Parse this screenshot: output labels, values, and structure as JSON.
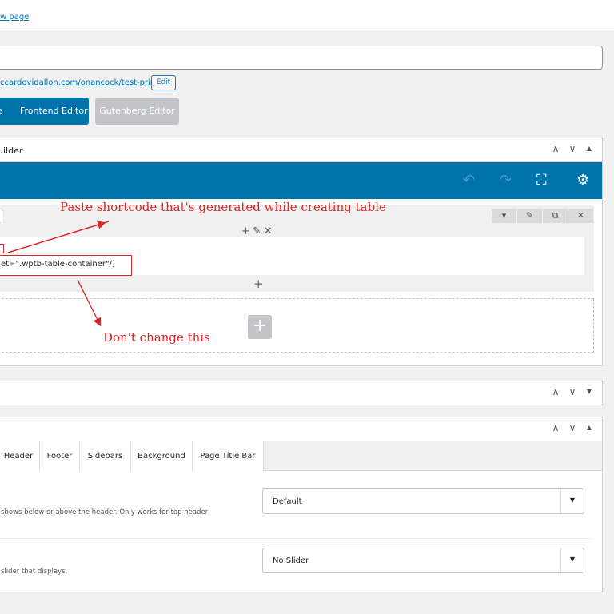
{
  "topbar": {
    "link_text": "w page"
  },
  "permalink": {
    "url_text": "ccardovidallon.com/onancock/test-print/",
    "edit_label": "Edit"
  },
  "editor_buttons": {
    "prefix": "e",
    "frontend_label": "Frontend Editor",
    "gutenberg_label": "Gutenberg Editor"
  },
  "builder_box": {
    "title": "uilder",
    "ctrl_up": "∧",
    "ctrl_down": "∨",
    "ctrl_toggle": "▲"
  },
  "toolbar": {
    "undo_icon": "↶",
    "redo_icon": "↷",
    "fullscreen_icon": "⛶",
    "settings_icon": "⚙"
  },
  "container_controls": {
    "collapse": "▾",
    "edit": "✎",
    "clone": "⧉",
    "delete": "✕"
  },
  "row_controls": "+✎✕",
  "shortcode": {
    "text": "et=\".wptb-table-container\"/]"
  },
  "plus_symbol": "+",
  "annotations": {
    "paste": "Paste shortcode that's generated while creating table",
    "dont_change": "Don't change this"
  },
  "collapsed_box": {
    "ctrl_up": "∧",
    "ctrl_down": "∨",
    "ctrl_toggle": "▼"
  },
  "options_box": {
    "ctrl_up": "∧",
    "ctrl_down": "∨",
    "ctrl_toggle": "▲",
    "tabs": [
      "Header",
      "Footer",
      "Sidebars",
      "Background",
      "Page Title Bar"
    ],
    "option1": {
      "desc": "shows below or above the header. Only works for top header",
      "value": "Default"
    },
    "option2": {
      "desc": "slider that displays.",
      "value": "No Slider"
    },
    "select_arrow": "▼"
  },
  "colors": {
    "accent": "#0073aa",
    "annotation": "#e02424"
  }
}
